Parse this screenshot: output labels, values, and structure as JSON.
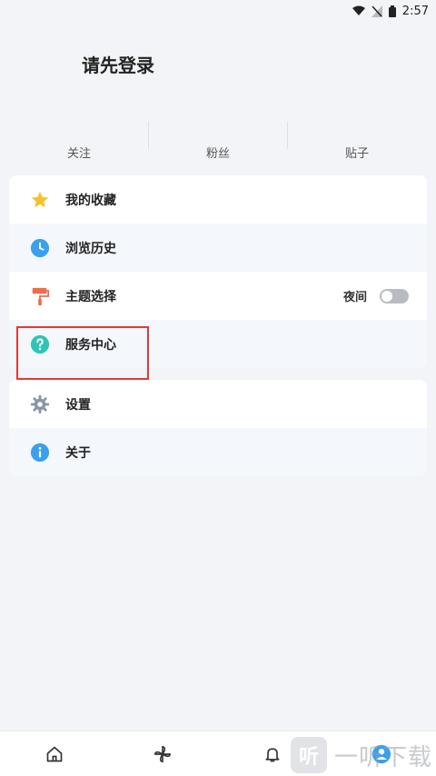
{
  "status_bar": {
    "time": "2:57"
  },
  "profile": {
    "login_prompt": "请先登录"
  },
  "stats": {
    "following": "关注",
    "fans": "粉丝",
    "posts": "贴子"
  },
  "menu_group_1": [
    {
      "label": "我的收藏",
      "icon": "star-icon"
    },
    {
      "label": "浏览历史",
      "icon": "clock-icon"
    },
    {
      "label": "主题选择",
      "icon": "paint-roller-icon",
      "switch_label": "夜间",
      "switch_on": false
    },
    {
      "label": "服务中心",
      "icon": "question-icon"
    }
  ],
  "menu_group_2": [
    {
      "label": "设置",
      "icon": "gear-icon"
    },
    {
      "label": "关于",
      "icon": "info-icon"
    }
  ],
  "bottom_nav": [
    "home-icon",
    "pinwheel-icon",
    "bell-icon",
    "profile-icon"
  ],
  "watermark": {
    "logo_char": "听",
    "text": "一听下载"
  },
  "colors": {
    "star": "#f6c22b",
    "clock": "#3aa0ee",
    "roller": "#f26b4a",
    "question": "#2ec4b6",
    "gear": "#8a95a5",
    "info": "#3aa0ee",
    "highlight": "#e53935"
  }
}
